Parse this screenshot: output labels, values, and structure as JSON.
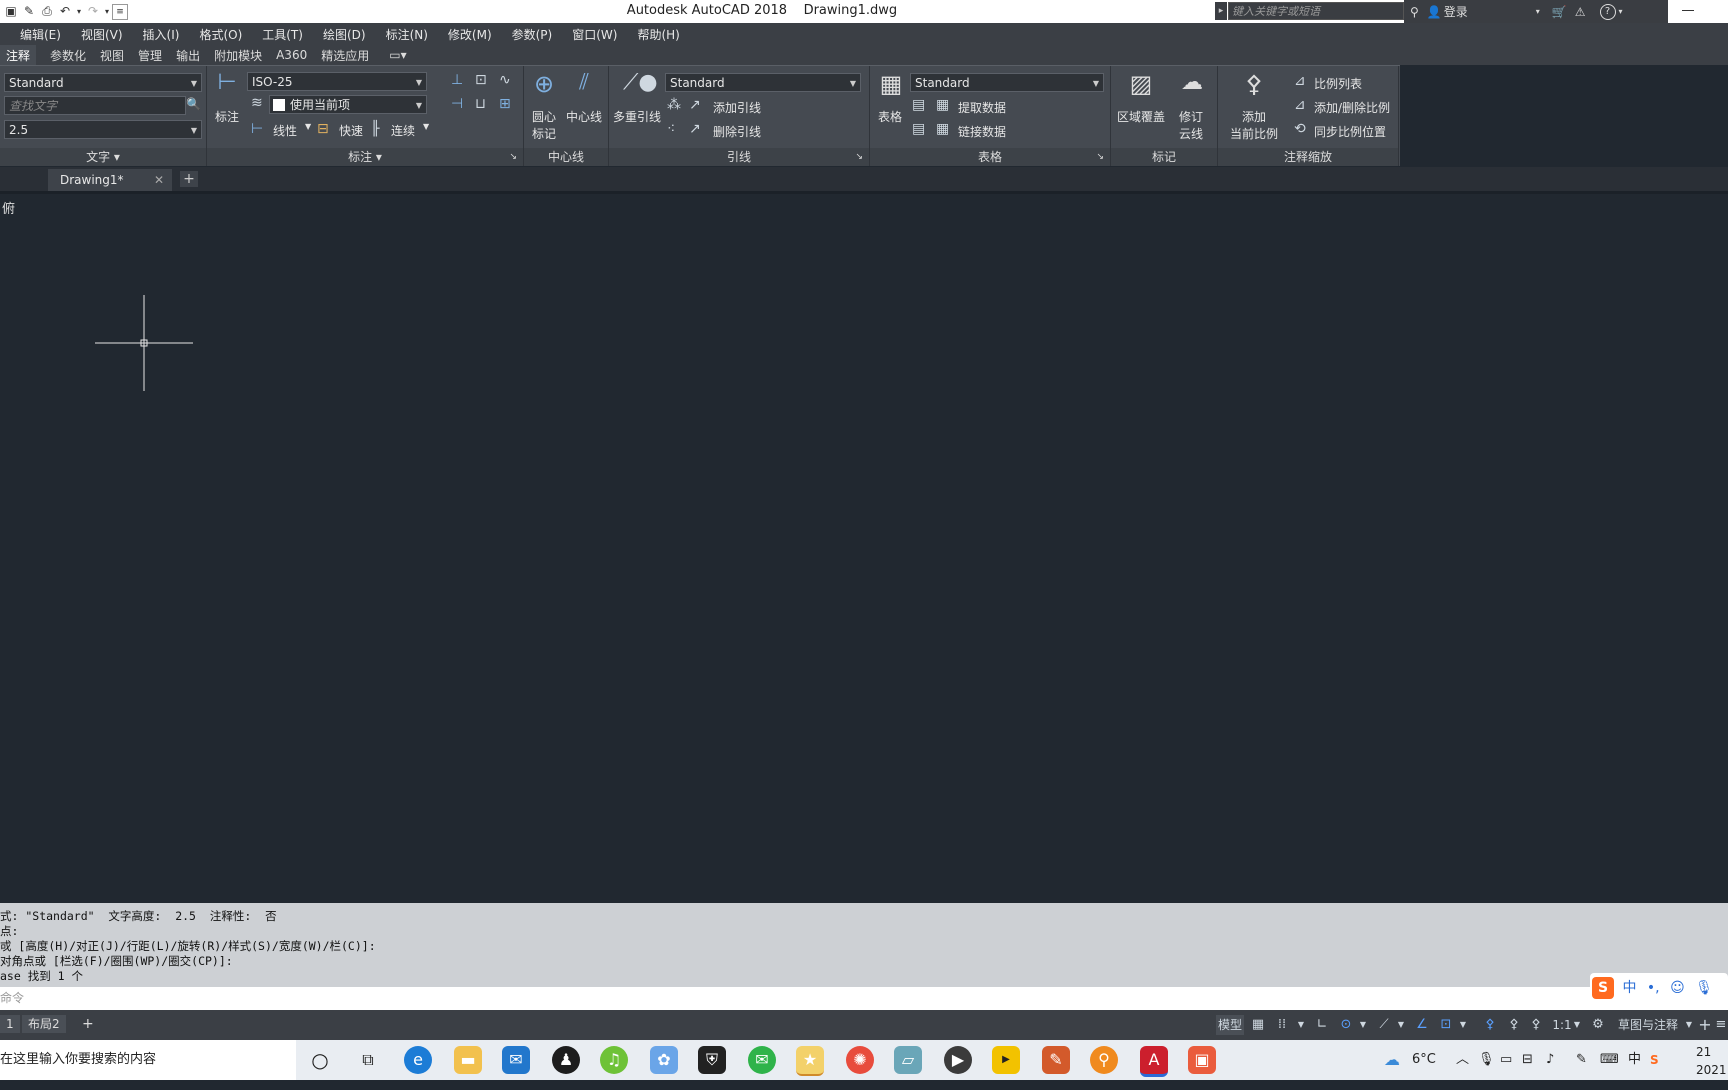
{
  "titlebar": {
    "app_title": "Autodesk AutoCAD 2018",
    "file_name": "Drawing1.dwg",
    "search_placeholder": "键入关键字或短语",
    "login_label": "登录"
  },
  "menu": [
    "编辑(E)",
    "视图(V)",
    "插入(I)",
    "格式(O)",
    "工具(T)",
    "绘图(D)",
    "标注(N)",
    "修改(M)",
    "参数(P)",
    "窗口(W)",
    "帮助(H)"
  ],
  "ribbon_tabs": [
    "注释",
    "参数化",
    "视图",
    "管理",
    "输出",
    "附加模块",
    "A360",
    "精选应用"
  ],
  "ribbon": {
    "text_panel": {
      "style": "Standard",
      "find_placeholder": "查找文字",
      "height": "2.5",
      "title": "文字"
    },
    "dim_panel": {
      "big_label": "标注",
      "style": "ISO-25",
      "layer": "使用当前项",
      "linear": "线性",
      "quick": "快速",
      "continue": "连续",
      "title": "标注"
    },
    "center_panel": {
      "center_mark_1": "圆心",
      "center_mark_2": "标记",
      "centerline": "中心线",
      "title": "中心线"
    },
    "leader_panel": {
      "multileader": "多重引线",
      "style": "Standard",
      "add": "添加引线",
      "remove": "删除引线",
      "title": "引线"
    },
    "table_panel": {
      "table": "表格",
      "style": "Standard",
      "extract": "提取数据",
      "link": "链接数据",
      "title": "表格"
    },
    "markup_panel": {
      "wipeout": "区域覆盖",
      "revcloud_1": "修订",
      "revcloud_2": "云线",
      "title": "标记"
    },
    "scale_panel": {
      "add_1": "添加",
      "add_2": "当前比例",
      "list": "比例列表",
      "add_delete": "添加/删除比例",
      "sync": "同步比例位置",
      "title": "注释缩放"
    }
  },
  "doc_tab": {
    "name": "Drawing1*"
  },
  "canvas": {
    "view_label": "俯"
  },
  "history": [
    "式: \"Standard\"  文字高度:  2.5  注释性:  否",
    "点:",
    "戓 [高度(H)/对正(J)/行距(L)/旋转(R)/样式(S)/宽度(W)/栏(C)]:",
    "对角点或 [栏选(F)/圈围(WP)/圈交(CP)]:",
    "ase 找到 1 个"
  ],
  "command_placeholder": "命令",
  "layout_tabs": [
    "1",
    "布局2"
  ],
  "status": {
    "model": "模型",
    "scale": "1:1",
    "workspace": "草图与注释"
  },
  "taskbar": {
    "search_text": "在这里输入你要搜索的内容",
    "temp": "6°C",
    "time": "21",
    "date": "2021"
  },
  "ime": {
    "label": "中"
  },
  "colors": {
    "canvas": "#212830",
    "ribbon": "#454a51",
    "history": "#cdd0d4"
  }
}
